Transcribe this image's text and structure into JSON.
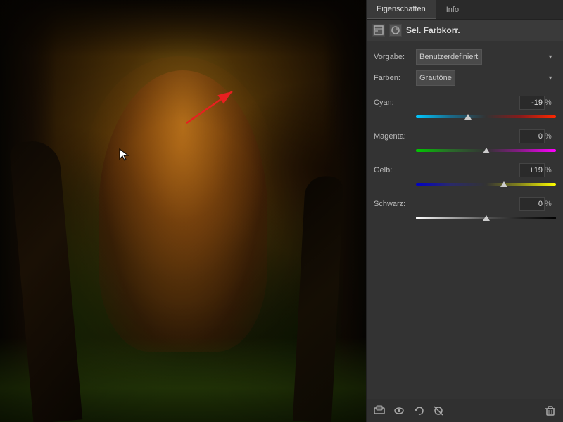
{
  "tabs": {
    "eigenschaften": "Eigenschaften",
    "info": "Info"
  },
  "header": {
    "title": "Sel. Farbkorr."
  },
  "fields": {
    "vorgabe_label": "Vorgabe:",
    "vorgabe_value": "Benutzerdefiniert",
    "farben_label": "Farben:",
    "farben_value": "Grautöne",
    "cyan_label": "Cyan:",
    "cyan_value": "-19",
    "cyan_unit": "%",
    "magenta_label": "Magenta:",
    "magenta_value": "0",
    "magenta_unit": "%",
    "gelb_label": "Gelb:",
    "gelb_value": "+19",
    "gelb_unit": "%",
    "schwarz_label": "Schwarz:",
    "schwarz_value": "0",
    "schwarz_unit": "%"
  },
  "footer_icons": [
    "clip-icon",
    "eye-icon",
    "undo-icon",
    "visibility-icon",
    "trash-icon"
  ]
}
